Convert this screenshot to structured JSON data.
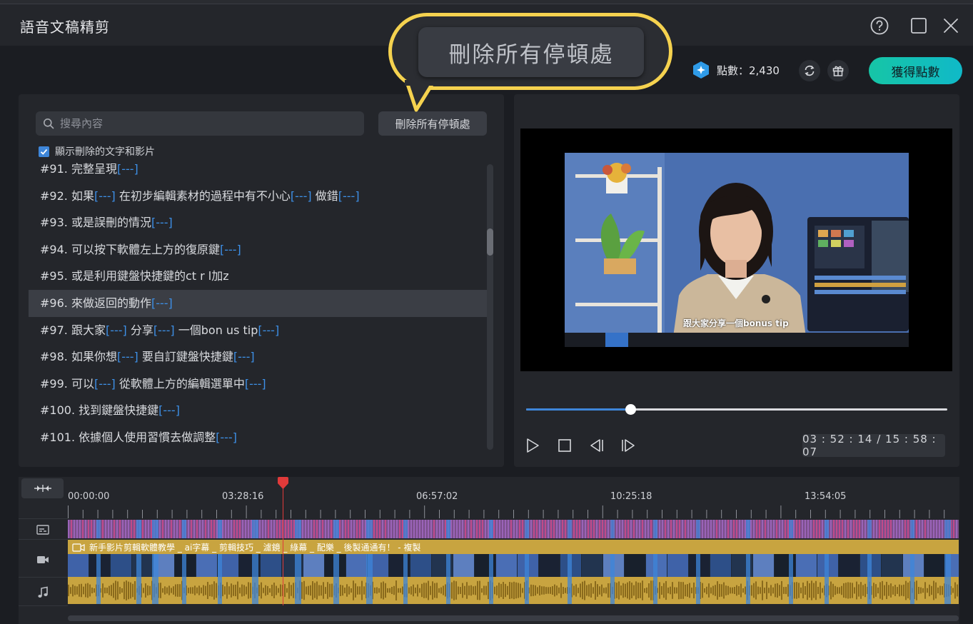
{
  "window": {
    "title": "語音文稿精剪"
  },
  "points": {
    "text": "點數：2,430",
    "get_button": "獲得點數"
  },
  "callout": {
    "text": "刪除所有停頓處"
  },
  "left": {
    "search_placeholder": "搜尋內容",
    "delete_button": "刪除所有停頓處",
    "show_deleted_label": "顯示刪除的文字和影片",
    "lines": [
      {
        "id": "#91.",
        "parts": [
          [
            "t",
            "完整呈現"
          ],
          [
            "p",
            "[---]"
          ]
        ]
      },
      {
        "id": "#92.",
        "parts": [
          [
            "t",
            "如果"
          ],
          [
            "p",
            "[---]"
          ],
          [
            "t",
            " 在初步編輯素材的過程中有不小心"
          ],
          [
            "p",
            "[---]"
          ],
          [
            "t",
            " 做錯"
          ],
          [
            "p",
            "[---]"
          ]
        ]
      },
      {
        "id": "#93.",
        "parts": [
          [
            "t",
            "或是誤刪的情況"
          ],
          [
            "p",
            "[---]"
          ]
        ]
      },
      {
        "id": "#94.",
        "parts": [
          [
            "t",
            "可以按下軟體左上方的復原鍵"
          ],
          [
            "p",
            "[---]"
          ]
        ]
      },
      {
        "id": "#95.",
        "parts": [
          [
            "t",
            "或是利用鍵盤快捷鍵的ct r l加z"
          ]
        ]
      },
      {
        "id": "#96.",
        "parts": [
          [
            "t",
            "來做返回的動作"
          ],
          [
            "p",
            "[---]"
          ]
        ],
        "selected": true
      },
      {
        "id": "#97.",
        "parts": [
          [
            "t",
            "跟大家"
          ],
          [
            "p",
            "[---]"
          ],
          [
            "t",
            " 分享"
          ],
          [
            "p",
            "[---]"
          ],
          [
            "t",
            " 一個bon us tip"
          ],
          [
            "p",
            "[---]"
          ]
        ]
      },
      {
        "id": "#98.",
        "parts": [
          [
            "t",
            "如果你想"
          ],
          [
            "p",
            "[---]"
          ],
          [
            "t",
            " 要自訂鍵盤快捷鍵"
          ],
          [
            "p",
            "[---]"
          ]
        ]
      },
      {
        "id": "#99.",
        "parts": [
          [
            "t",
            "可以"
          ],
          [
            "p",
            "[---]"
          ],
          [
            "t",
            " 從軟體上方的編輯選單中"
          ],
          [
            "p",
            "[---]"
          ]
        ]
      },
      {
        "id": "#100.",
        "parts": [
          [
            "t",
            "找到鍵盤快捷鍵"
          ],
          [
            "p",
            "[---]"
          ]
        ]
      },
      {
        "id": "#101.",
        "parts": [
          [
            "t",
            "依據個人使用習慣去做調整"
          ],
          [
            "p",
            "[---]"
          ]
        ]
      }
    ]
  },
  "preview": {
    "subtitle": "跟大家分享一個bonus tip",
    "timecode": "03 : 52 : 14 / 15 : 58 : 07",
    "progress": 0.248
  },
  "timeline": {
    "ticks": [
      "00:00:00",
      "03:28:16",
      "06:57:02",
      "10:25:18",
      "13:54:05"
    ],
    "clip_title": "新手影片剪輯軟體教學 _ ai字幕 _ 剪輯技巧 _ 濾鏡 _ 綠幕 _ 配樂 _ 後製通通有！ - 複製",
    "playhead_fraction": 0.242
  },
  "colors": {
    "accent": "#3e86d9",
    "pause": "#3d8fe6",
    "callout_border": "#f5d24f",
    "get_points": "#16c5a6"
  },
  "icons": [
    "help-icon",
    "maximize-icon",
    "close-icon",
    "points-diamond-icon",
    "refresh-icon",
    "gift-icon",
    "search-icon",
    "checkbox-check-icon",
    "play-icon",
    "stop-icon",
    "prev-frame-icon",
    "next-frame-icon",
    "fit-timeline-icon",
    "subtitle-track-icon",
    "video-track-icon",
    "music-track-icon"
  ]
}
